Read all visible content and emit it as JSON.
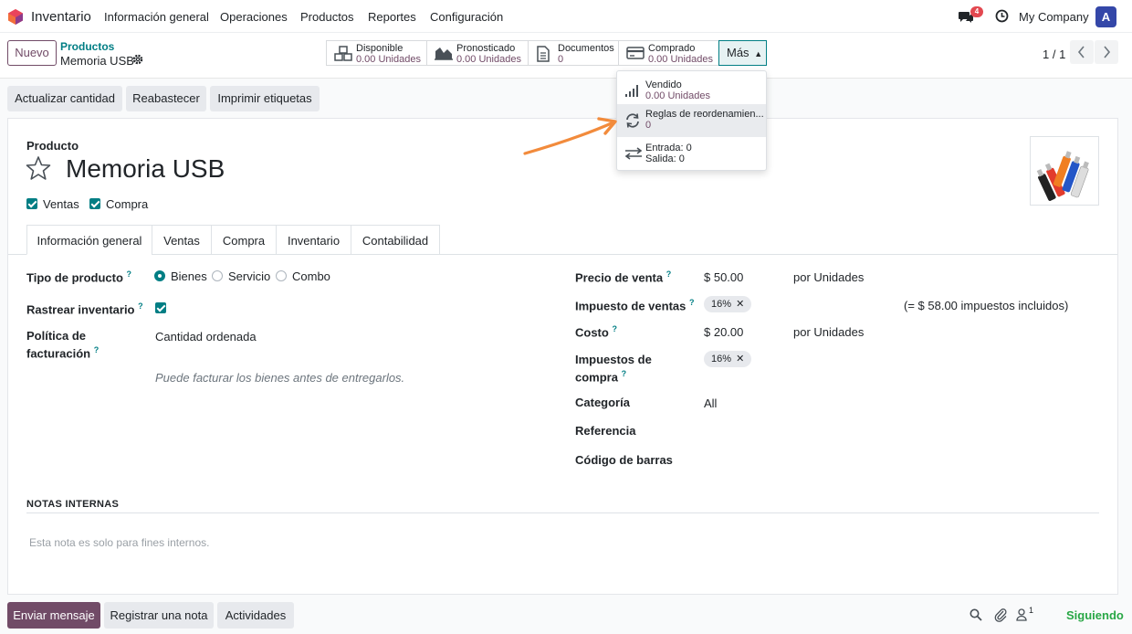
{
  "navbar": {
    "app_name": "Inventario",
    "menu": [
      "Información general",
      "Operaciones",
      "Productos",
      "Reportes",
      "Configuración"
    ],
    "messages_count": "4",
    "company": "My Company",
    "avatar_letter": "A"
  },
  "control": {
    "new_button": "Nuevo",
    "breadcrumb_parent": "Productos",
    "breadcrumb_current": "Memoria USB",
    "stats": [
      {
        "label": "Disponible",
        "value": "0.00 Unidades"
      },
      {
        "label": "Pronosticado",
        "value": "0.00 Unidades"
      },
      {
        "label": "Documentos",
        "value": "0"
      },
      {
        "label": "Comprado",
        "value": "0.00 Unidades"
      }
    ],
    "more_button": "Más",
    "pager": "1 / 1"
  },
  "dropdown": {
    "items": [
      {
        "line1": "Vendido",
        "line2": "0.00 Unidades"
      },
      {
        "line1": "Reglas de reordenamien...",
        "line2": "0"
      },
      {
        "line1": "Entrada: 0",
        "line2": "Salida: 0"
      }
    ]
  },
  "actions": [
    "Actualizar cantidad",
    "Reabastecer",
    "Imprimir etiquetas"
  ],
  "product": {
    "label": "Producto",
    "name": "Memoria USB",
    "checkboxes": [
      "Ventas",
      "Compra"
    ]
  },
  "tabs": [
    "Información general",
    "Ventas",
    "Compra",
    "Inventario",
    "Contabilidad"
  ],
  "left_fields": {
    "type_label": "Tipo de producto",
    "type_options": [
      "Bienes",
      "Servicio",
      "Combo"
    ],
    "track_label": "Rastrear inventario",
    "billing_label_1": "Política de",
    "billing_label_2": "facturación",
    "billing_value": "Cantidad ordenada",
    "hint": "Puede facturar los bienes antes de entregarlos."
  },
  "right_fields": {
    "price_label": "Precio de venta",
    "price_value": "$ 50.00",
    "price_unit": "por Unidades",
    "sales_tax_label": "Impuesto de ventas",
    "sales_tax_tag": "16%",
    "tax_included": "(= $ 58.00 impuestos incluidos)",
    "cost_label": "Costo",
    "cost_value": "$ 20.00",
    "cost_unit": "por Unidades",
    "purchase_tax_label_1": "Impuestos de",
    "purchase_tax_label_2": "compra",
    "purchase_tax_tag": "16%",
    "category_label": "Categoría",
    "category_value": "All",
    "reference_label": "Referencia",
    "barcode_label": "Código de barras"
  },
  "notes": {
    "title": "NOTAS INTERNAS",
    "placeholder": "Esta nota es solo para fines internos."
  },
  "chatter": {
    "send": "Enviar mensaje",
    "log": "Registrar una nota",
    "activities": "Actividades",
    "followers_count": "1",
    "following": "Siguiendo"
  },
  "colors": {
    "brand": "#714b67",
    "accent": "#017e84",
    "badge": "#e34850"
  }
}
